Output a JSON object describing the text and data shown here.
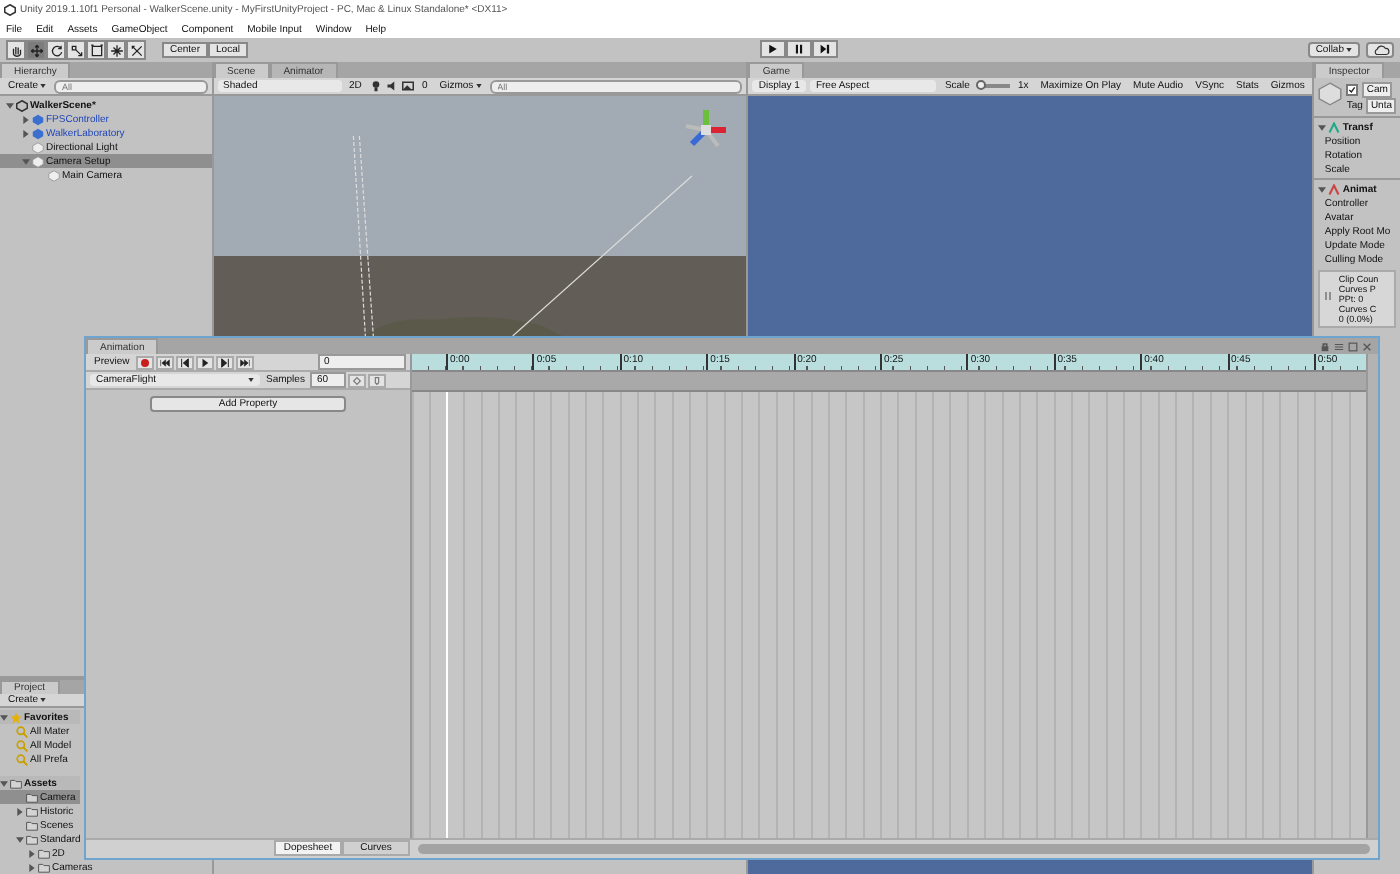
{
  "window": {
    "title": "Unity 2019.1.10f1 Personal - WalkerScene.unity - MyFirstUnityProject - PC, Mac & Linux Standalone* <DX11>"
  },
  "menu": [
    "File",
    "Edit",
    "Assets",
    "GameObject",
    "Component",
    "Mobile Input",
    "Window",
    "Help"
  ],
  "toolbar": {
    "tools": [
      {
        "kind": "hand",
        "selected": false
      },
      {
        "kind": "move",
        "selected": true
      },
      {
        "kind": "rotate",
        "selected": false
      },
      {
        "kind": "scale",
        "selected": false
      },
      {
        "kind": "rect",
        "selected": false
      },
      {
        "kind": "transform",
        "selected": false
      },
      {
        "kind": "custom",
        "selected": false
      }
    ],
    "pivot": [
      {
        "label": "Center"
      },
      {
        "label": "Local"
      }
    ],
    "collab": "Collab"
  },
  "hierarchy": {
    "tab": "Hierarchy",
    "create": "Create",
    "search": {
      "placeholder": "All"
    },
    "items": [
      {
        "label": "WalkerScene*",
        "kind": "scene",
        "selected": false,
        "expanded": true,
        "children": [
          {
            "label": "FPSController",
            "kind": "prefab",
            "selected": false,
            "expanded": false
          },
          {
            "label": "WalkerLaboratory",
            "kind": "prefab",
            "selected": false,
            "expanded": false
          },
          {
            "label": "Directional Light",
            "kind": "object",
            "selected": false
          },
          {
            "label": "Camera Setup",
            "kind": "object",
            "selected": true,
            "expanded": true,
            "children": [
              {
                "label": "Main Camera",
                "kind": "object",
                "selected": false
              }
            ]
          }
        ]
      }
    ]
  },
  "scene": {
    "tabs": [
      {
        "label": "Scene",
        "selected": true
      },
      {
        "label": "Animator",
        "selected": false
      }
    ],
    "shading": "Shaded",
    "mode_2d": "2D",
    "light_value": "0",
    "gizmos": "Gizmos",
    "search": {
      "placeholder": "All"
    }
  },
  "game": {
    "tab": "Game",
    "display": "Display 1",
    "aspect": "Free Aspect",
    "scale_label": "Scale",
    "scale_value": "1x",
    "scale": {
      "level": 0.05
    },
    "toggles": [
      {
        "label": "Maximize On Play"
      },
      {
        "label": "Mute Audio"
      },
      {
        "label": "VSync"
      },
      {
        "label": "Stats"
      },
      {
        "label": "Gizmos"
      }
    ]
  },
  "inspector": {
    "tab": "Inspector",
    "object": {
      "active": true,
      "name": "Cam",
      "tag_label": "Tag",
      "tag": "Unta"
    },
    "components": [
      {
        "title": "Transf",
        "expanded": true,
        "fields": [
          "Position",
          "Rotation",
          "Scale"
        ]
      },
      {
        "title": "Animat",
        "expanded": true,
        "fields": [
          "Controller",
          "Avatar",
          "Apply Root Mo",
          "Update Mode",
          "Culling Mode"
        ]
      }
    ],
    "info": [
      "Clip Coun",
      "Curves P",
      "PPt: 0",
      "Curves C",
      "0 (0.0%)"
    ]
  },
  "project": {
    "tab": "Project",
    "create": "Create",
    "favorites": {
      "label": "Favorites",
      "expanded": true,
      "items": [
        "All Mater",
        "All Model",
        "All Prefa"
      ]
    },
    "assets": {
      "label": "Assets",
      "expanded": true,
      "items": [
        {
          "label": "Camera",
          "selected": true
        },
        {
          "label": "Historic",
          "selected": false,
          "expanded": false
        },
        {
          "label": "Scenes",
          "selected": false
        },
        {
          "label": "Standard",
          "selected": false,
          "expanded": true,
          "children": [
            {
              "label": "2D",
              "selected": false,
              "expanded": false
            },
            {
              "label": "Cameras",
              "selected": false,
              "expanded": false
            }
          ]
        }
      ]
    }
  },
  "animation": {
    "tab": "Animation",
    "preview": "Preview",
    "recording": false,
    "frame": "0",
    "clip": "CameraFlight",
    "samples_label": "Samples",
    "samples": "60",
    "add_property": "Add Property",
    "ticks": [
      "0:00",
      "0:05",
      "0:10",
      "0:15",
      "0:20",
      "0:25",
      "0:30",
      "0:35",
      "0:40",
      "0:45",
      "0:50"
    ],
    "views": [
      {
        "label": "Dopesheet",
        "selected": true
      },
      {
        "label": "Curves",
        "selected": false
      }
    ]
  }
}
